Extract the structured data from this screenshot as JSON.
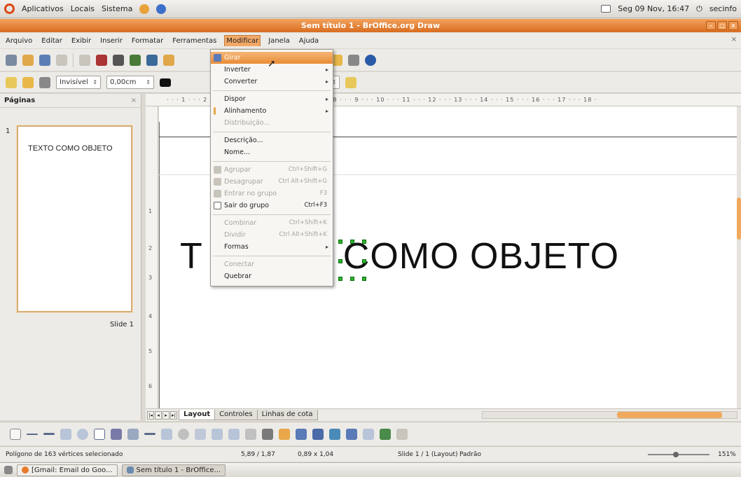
{
  "top_panel": {
    "menus": [
      "Aplicativos",
      "Locais",
      "Sistema"
    ],
    "clock": "Seg 09 Nov, 16:47",
    "user": "secinfo"
  },
  "window": {
    "title": "Sem título 1 - BrOffice.org Draw"
  },
  "menubar": {
    "items": [
      "Arquivo",
      "Editar",
      "Exibir",
      "Inserir",
      "Formatar",
      "Ferramentas",
      "Modificar",
      "Janela",
      "Ajuda"
    ],
    "active": "Modificar"
  },
  "toolbar2": {
    "line_style": "Invisível",
    "line_width": "0,00cm",
    "area_field": "[]"
  },
  "pages_pane": {
    "title": "Páginas",
    "slide_number": "1",
    "thumb_text": "TEXTO COMO OBJETO",
    "slide_label": "Slide 1"
  },
  "ruler": {
    "ticks": "· · · 1 · · · 2 · · · 3 · · · 4 · · · 5 · · · 6 · · · 7 · · · 8 · · · 9 · · · 10 · · · 11 · · · 12 · · · 13 · · · 14 · · · 15 · · · 16 · · · 17 · · · 18 ·",
    "vticks": [
      "1",
      "2",
      "3",
      "4",
      "5",
      "6"
    ]
  },
  "canvas": {
    "text_left": "T",
    "text_right": "COMO OBJETO"
  },
  "tabs": {
    "items": [
      "Layout",
      "Controles",
      "Linhas de cota"
    ],
    "active": "Layout"
  },
  "status": {
    "selection": "Polígono de 163 vértices selecionado",
    "position": "5,89 / 1,87",
    "size": "0,89 x 1,04",
    "slide": "Slide 1 / 1 (Layout)",
    "style": "Padrão",
    "zoom": "151%"
  },
  "taskbar": {
    "items": [
      "[Gmail: Email do Goo...",
      "Sem título 1 - BrOffice..."
    ]
  },
  "dropdown": {
    "items": [
      {
        "label": "Girar",
        "highlighted": true
      },
      {
        "label": "Inverter",
        "submenu": true
      },
      {
        "label": "Converter",
        "submenu": true
      },
      {
        "label": "Dispor",
        "submenu": true
      },
      {
        "label": "Alinhamento",
        "submenu": true
      },
      {
        "label": "Distribuição...",
        "disabled": true
      },
      {
        "label": "Descrição..."
      },
      {
        "label": "Nome..."
      },
      {
        "label": "Agrupar",
        "shortcut": "Ctrl+Shift+G",
        "disabled": true
      },
      {
        "label": "Desagrupar",
        "shortcut": "Ctrl Alt+Shift+G",
        "disabled": true
      },
      {
        "label": "Entrar no grupo",
        "shortcut": "F3",
        "disabled": true
      },
      {
        "label": "Sair do grupo",
        "shortcut": "Ctrl+F3"
      },
      {
        "label": "Combinar",
        "shortcut": "Ctrl+Shift+K",
        "disabled": true
      },
      {
        "label": "Dividir",
        "shortcut": "Ctrl Alt+Shift+K",
        "disabled": true
      },
      {
        "label": "Formas",
        "submenu": true
      },
      {
        "label": "Conectar",
        "disabled": true
      },
      {
        "label": "Quebrar"
      }
    ]
  },
  "colors": {
    "accent": "#e98c36",
    "title_bar": "#d96d20"
  }
}
